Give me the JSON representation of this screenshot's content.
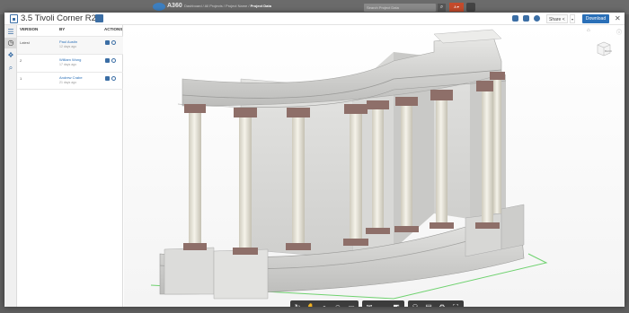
{
  "topbar": {
    "brand": "A360",
    "crumbs_prefix": "Dashboard / All Projects / Project Name /",
    "crumbs_current": "Project Data",
    "search_placeholder": "Search Project Data",
    "red_button_label": "A ▾",
    "search_button_glyph": "⌕"
  },
  "header": {
    "title": "3.5 Tivoli Corner R2...",
    "share_label": "Share",
    "share_glyph": "<",
    "caret_glyph": "▾",
    "download_label": "Download",
    "close_glyph": "✕"
  },
  "rail": {
    "icons": [
      "properties-icon",
      "history-icon",
      "layers-icon",
      "search-icon"
    ],
    "glyphs": [
      "☰",
      "◷",
      "❖",
      "⌕"
    ]
  },
  "versions": {
    "columns": [
      "VERSION",
      "BY",
      "ACTIONS"
    ],
    "rows": [
      {
        "version": "Latest",
        "by": "Paul Austin",
        "when": "12 days ago"
      },
      {
        "version": "2",
        "by": "William Wong",
        "when": "17 days ago"
      },
      {
        "version": "1",
        "by": "Andrew Crabe",
        "when": "21 days ago"
      }
    ]
  },
  "viewer": {
    "home_glyph": "⌂",
    "info_glyph": "ⓘ",
    "viewcube_label": "BACK"
  },
  "toolbar": {
    "groups": [
      {
        "name": "navigation",
        "tools": [
          "orbit-icon",
          "pan-icon",
          "zoom-icon",
          "first-person-icon",
          "camera-icon"
        ],
        "glyphs": [
          "↻",
          "✋",
          "⌕",
          "☺",
          "▭"
        ]
      },
      {
        "name": "markup",
        "tools": [
          "comment-icon",
          "measure-icon",
          "section-icon"
        ],
        "glyphs": [
          "✉",
          "↔",
          "◩"
        ]
      },
      {
        "name": "settings",
        "tools": [
          "model-browser-icon",
          "properties-icon",
          "settings-icon",
          "fullscreen-icon"
        ],
        "glyphs": [
          "⚇",
          "▤",
          "⚙",
          "⛶"
        ]
      }
    ]
  }
}
